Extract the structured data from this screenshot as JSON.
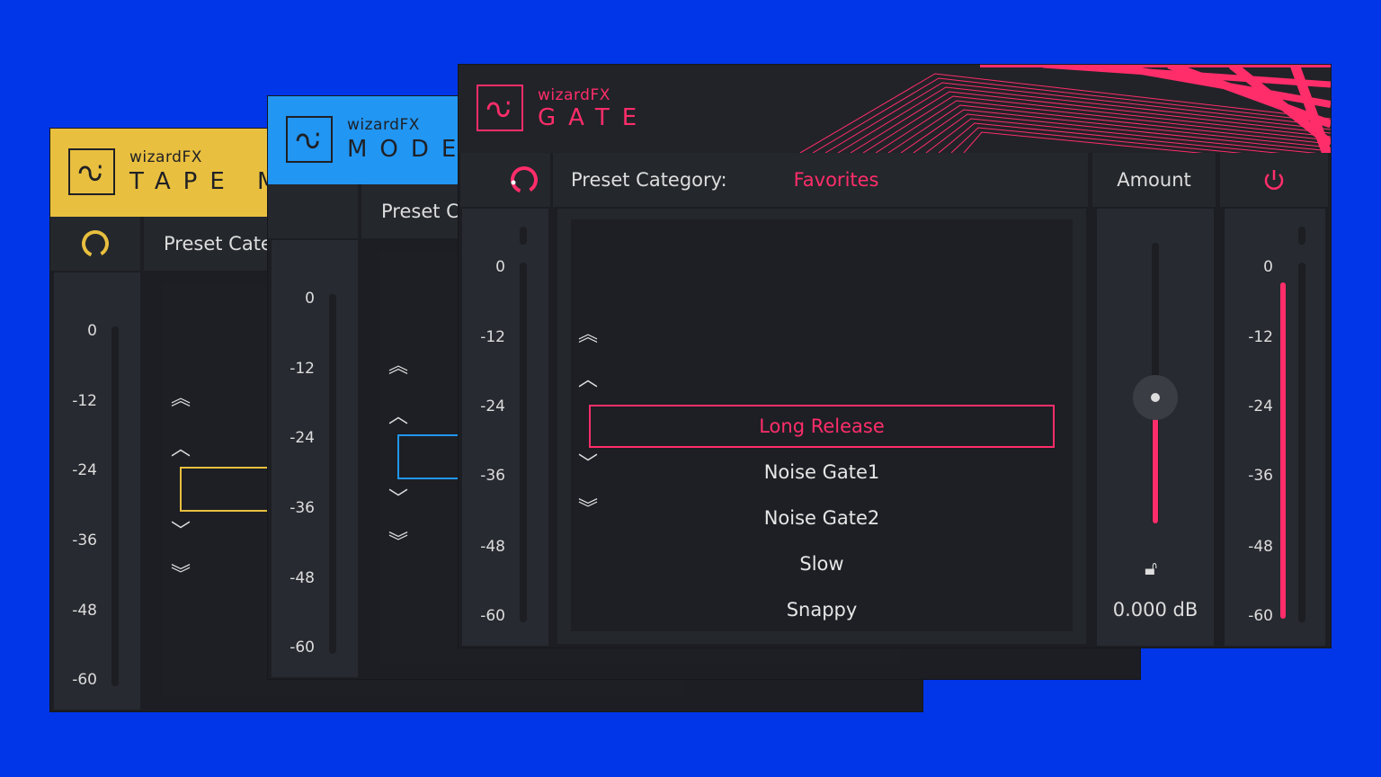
{
  "background_color": "#0036e8",
  "meter_ticks": [
    "0",
    "-12",
    "-24",
    "-36",
    "-48",
    "-60"
  ],
  "windows": {
    "tape": {
      "brand": "wizardFX",
      "product": "TAPE M",
      "accent": "#e8bf3f",
      "preset_label": "Preset Cate"
    },
    "mode": {
      "brand": "wizardFX",
      "product": "MODE",
      "accent": "#2196f3",
      "preset_label": "Preset Ca"
    },
    "gate": {
      "brand": "wizardFX",
      "product": "GATE",
      "accent": "#ff2d6a",
      "preset_label": "Preset Category:",
      "preset_category": "Favorites",
      "amount_label": "Amount",
      "amount_value": "0.000 dB",
      "amount_level": 0.45,
      "presets": [
        {
          "name": "Long Release",
          "selected": true
        },
        {
          "name": "Noise Gate1"
        },
        {
          "name": "Noise Gate2"
        },
        {
          "name": "Slow"
        },
        {
          "name": "Snappy"
        }
      ],
      "output_level": 0.96
    }
  }
}
